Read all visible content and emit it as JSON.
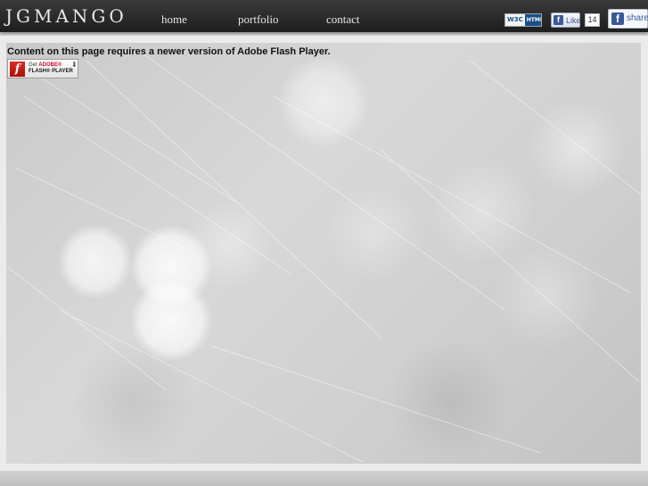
{
  "header": {
    "logo": "JGMANGO",
    "nav": [
      {
        "label": "home"
      },
      {
        "label": "portfolio"
      },
      {
        "label": "contact"
      }
    ]
  },
  "badges": {
    "w3c_mark": "W3C",
    "w3c_html": "HTML",
    "fb_like_label": "Like",
    "fb_like_count": "14",
    "fb_share_label": "share"
  },
  "content": {
    "flash_notice": "Content on this page requires a newer version of Adobe Flash Player.",
    "flash_badge": {
      "get": "Get",
      "adobe": "ADOBE®",
      "player": "FLASH® PLAYER"
    }
  },
  "colors": {
    "topbar": "#2a2a2a",
    "facebook_blue": "#3b5998",
    "flash_red": "#c8102e",
    "background": "#d6d6d6"
  },
  "icons": {
    "facebook": "facebook-icon",
    "flash": "flash-icon",
    "download": "download-arrow-icon"
  }
}
